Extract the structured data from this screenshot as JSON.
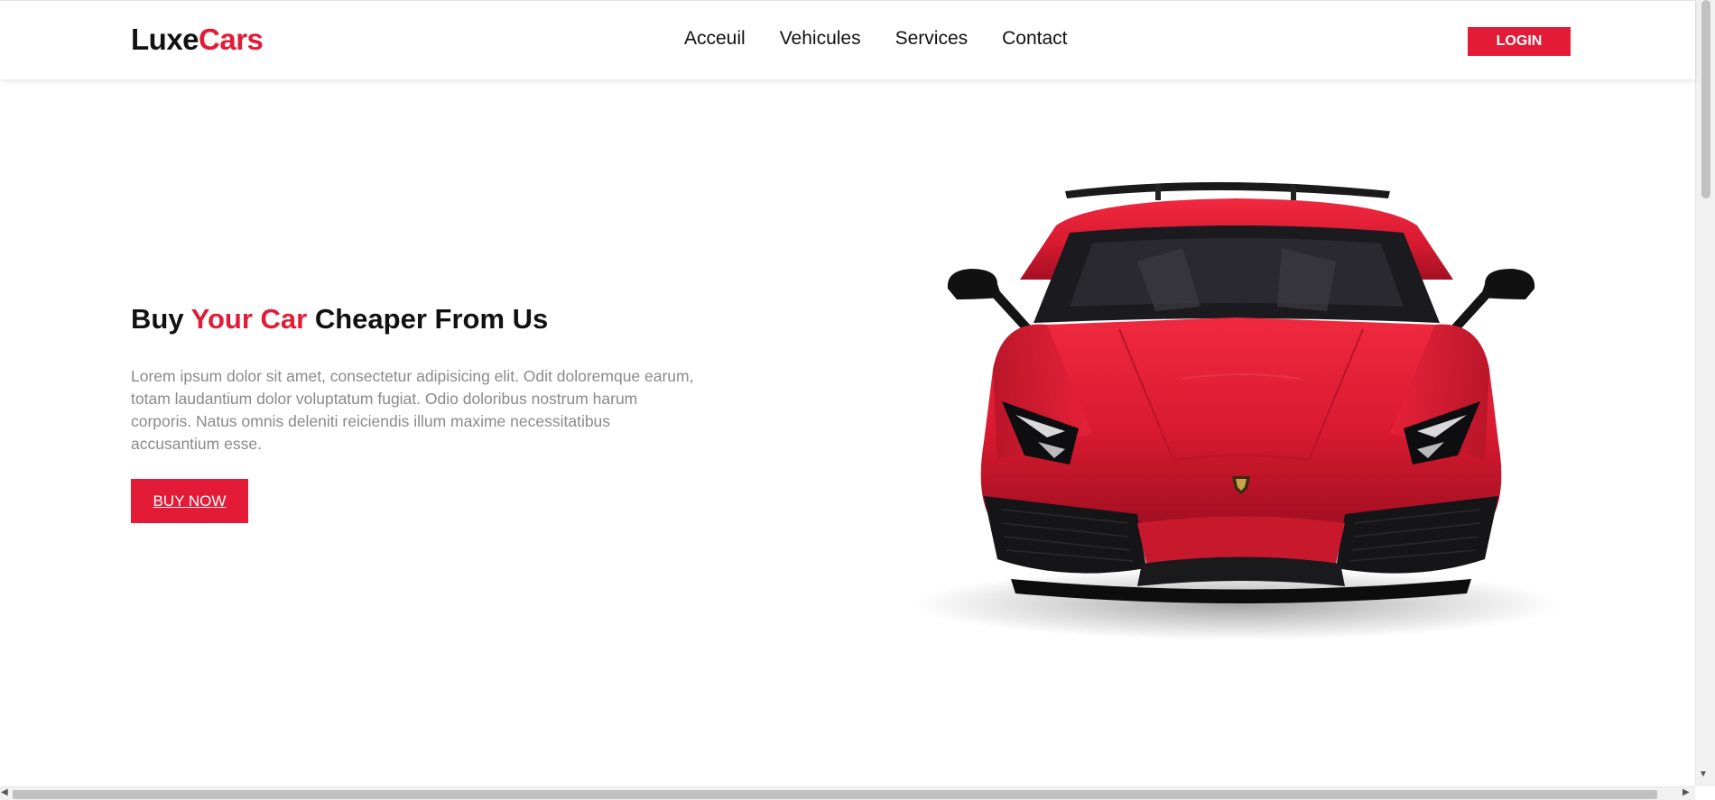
{
  "header": {
    "logo_part1": "Luxe",
    "logo_part2": "Cars",
    "nav": [
      {
        "label": "Acceuil"
      },
      {
        "label": "Vehicules"
      },
      {
        "label": "Services"
      },
      {
        "label": "Contact"
      }
    ],
    "login_label": "LOGIN"
  },
  "hero": {
    "title_part1": "Buy ",
    "title_accent": "Your Car",
    "title_part2": " Cheaper From Us",
    "description": "Lorem ipsum dolor sit amet, consectetur adipisicing elit. Odit doloremque earum, totam laudantium dolor voluptatum fugiat. Odio doloribus nostrum harum corporis. Natus omnis deleniti reiciendis illum maxime necessitatibus accusantium esse.",
    "cta_label": "BUY NOW",
    "image": "red-sports-car"
  },
  "colors": {
    "accent": "#e31b36",
    "text_dark": "#111111",
    "text_muted": "#8a8a8a",
    "background": "#ffffff"
  }
}
